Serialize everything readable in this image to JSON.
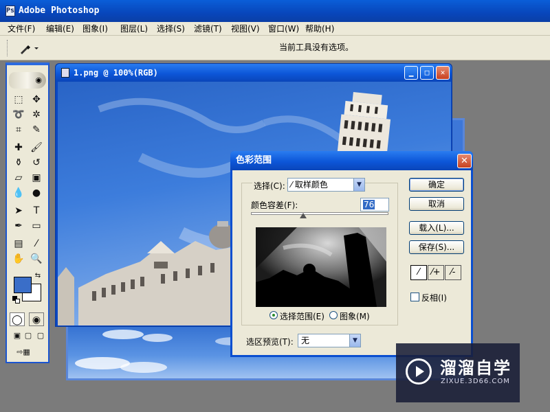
{
  "app": {
    "title": "Adobe Photoshop",
    "icon": "photoshop-app-icon"
  },
  "menubar": {
    "items": [
      "文件(F)",
      "编辑(E)",
      "图象(I)",
      "图层(L)",
      "选择(S)",
      "滤镜(T)",
      "视图(V)",
      "窗口(W)",
      "帮助(H)"
    ]
  },
  "options": {
    "tool": "eyedropper-tool",
    "hint": "当前工具没有选项。"
  },
  "toolbox": {
    "tools": [
      "rectangle-marquee",
      "move",
      "lasso",
      "magic-wand",
      "crop",
      "slice",
      "healing-brush",
      "brush",
      "clone-stamp",
      "history-brush",
      "eraser",
      "gradient",
      "blur",
      "dodge",
      "path-selection",
      "type",
      "pen",
      "rectangle-shape",
      "notes",
      "eyedropper",
      "hand",
      "zoom"
    ],
    "foreground_color": "#3a6ec8",
    "background_color": "#ffffff"
  },
  "document": {
    "title": "1.png @ 100%(RGB)"
  },
  "dialog": {
    "title": "色彩范围",
    "select_label": "选择(C):",
    "select_value": "取样颜色",
    "fuzziness_label": "颜色容差(F):",
    "fuzziness_value": "76",
    "radio_selection": "选择范围(E)",
    "radio_image": "图象(M)",
    "preview_label": "选区预览(T):",
    "preview_value": "无",
    "buttons": {
      "ok": "确定",
      "cancel": "取消",
      "load": "载入(L)...",
      "save": "保存(S)..."
    },
    "invert_label": "反相(I)"
  },
  "watermark": {
    "brand_cn": "溜溜自学",
    "brand_url": "ZIXUE.3D66.COM"
  },
  "colors": {
    "titlebar_blue": "#0846bb",
    "dialog_bg": "#ece9d8",
    "selection_blue": "#316ac5"
  }
}
